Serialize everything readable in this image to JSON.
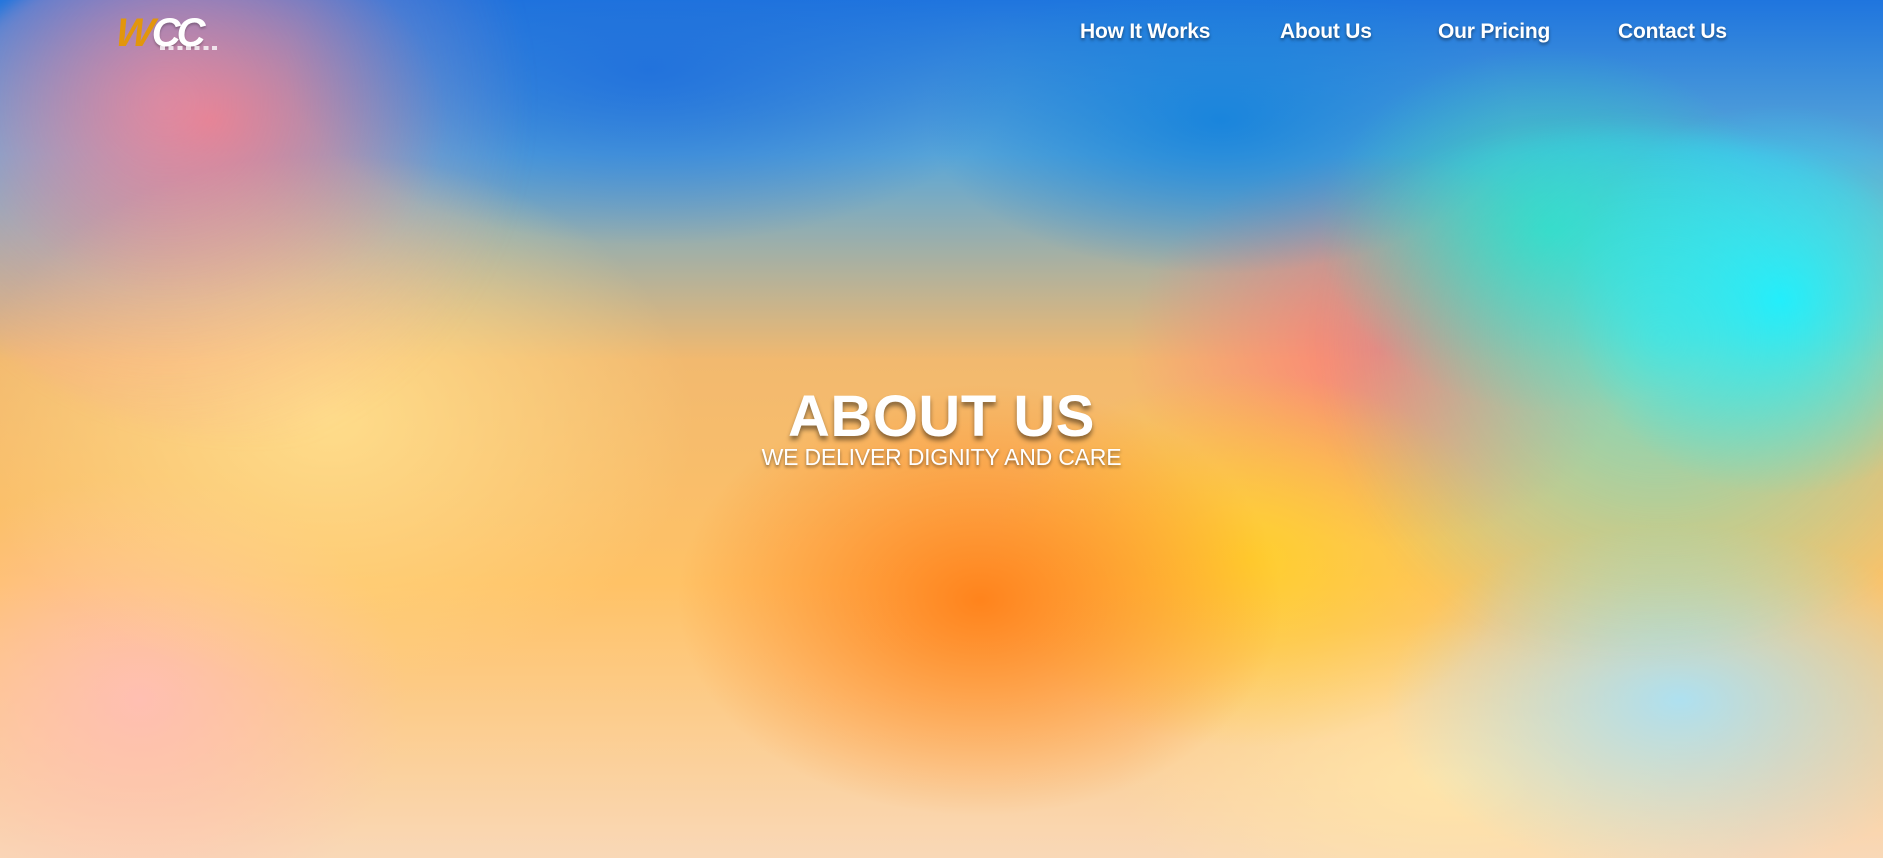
{
  "brand": {
    "logo_letter_w": "W",
    "logo_letters_cc": "CC",
    "accent_color": "#e2960c"
  },
  "nav": {
    "items": [
      {
        "label": "How It Works"
      },
      {
        "label": "About Us"
      },
      {
        "label": "Our Pricing"
      },
      {
        "label": "Contact Us"
      }
    ]
  },
  "hero": {
    "title": "ABOUT US",
    "subtitle": "WE DELIVER DIGNITY AND CARE"
  }
}
